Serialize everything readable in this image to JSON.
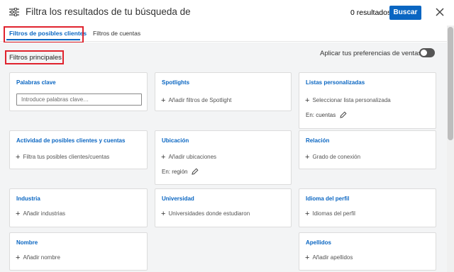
{
  "header": {
    "title": "Filtra los resultados de tu búsqueda de",
    "results_count": "0",
    "results_label": "resultados",
    "search_button": "Buscar"
  },
  "tabs": [
    {
      "label": "Filtros de posibles clientes",
      "active": true
    },
    {
      "label": "Filtros de cuentas",
      "active": false
    }
  ],
  "section": {
    "title": "Filtros principales",
    "preference_label": "Aplicar tus preferencias de ventas",
    "preference_enabled": false
  },
  "cards": {
    "keywords": {
      "title": "Palabras clave",
      "placeholder": "Introduce palabras clave…"
    },
    "spotlights": {
      "title": "Spotlights",
      "action": "Añadir filtros de Spotlight"
    },
    "custom_lists": {
      "title": "Listas personalizadas",
      "action": "Seleccionar lista personalizada",
      "sub": "En: cuentas"
    },
    "activity": {
      "title": "Actividad de posibles clientes y cuentas",
      "action": "Filtra tus posibles clientes/cuentas"
    },
    "location": {
      "title": "Ubicación",
      "action": "Añadir ubicaciones",
      "sub": "En: región"
    },
    "relationship": {
      "title": "Relación",
      "action": "Grado de conexión"
    },
    "industry": {
      "title": "Industria",
      "action": "Añadir industrias"
    },
    "university": {
      "title": "Universidad",
      "action": "Universidades donde estudiaron"
    },
    "profile_language": {
      "title": "Idioma del perfil",
      "action": "Idiomas del perfil"
    },
    "first_name": {
      "title": "Nombre",
      "action": "Añadir nombre"
    },
    "last_name": {
      "title": "Apellidos",
      "action": "Añadir apellidos"
    }
  },
  "colors": {
    "accent": "#0a66c2",
    "highlight": "#e0232e",
    "background": "#f3f4f5"
  }
}
